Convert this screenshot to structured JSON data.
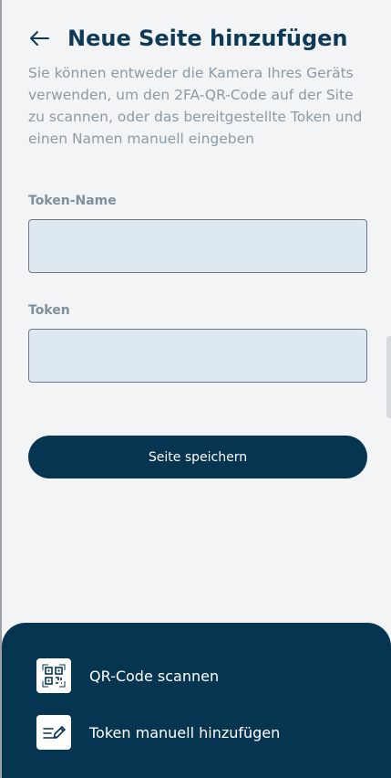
{
  "header": {
    "back_icon": "arrow-left-icon",
    "title": "Neue Seite hinzufügen"
  },
  "description": "Sie können entweder die Kamera Ihres Geräts verwenden, um den 2FA-QR-Code auf der Site zu scannen, oder das bereitgestellte Token und einen Namen manuell eingeben",
  "form": {
    "token_name_label": "Token-Name",
    "token_name_value": "",
    "token_label": "Token",
    "token_value": "",
    "save_label": "Seite speichern"
  },
  "sheet": {
    "items": [
      {
        "icon": "qr-code-icon",
        "label": "QR-Code scannen"
      },
      {
        "icon": "edit-text-icon",
        "label": "Token manuell hinzufügen"
      }
    ]
  },
  "colors": {
    "primary": "#063552",
    "title": "#0e3a56",
    "muted_text": "#8a9aa6",
    "input_bg": "#dde8f1"
  }
}
